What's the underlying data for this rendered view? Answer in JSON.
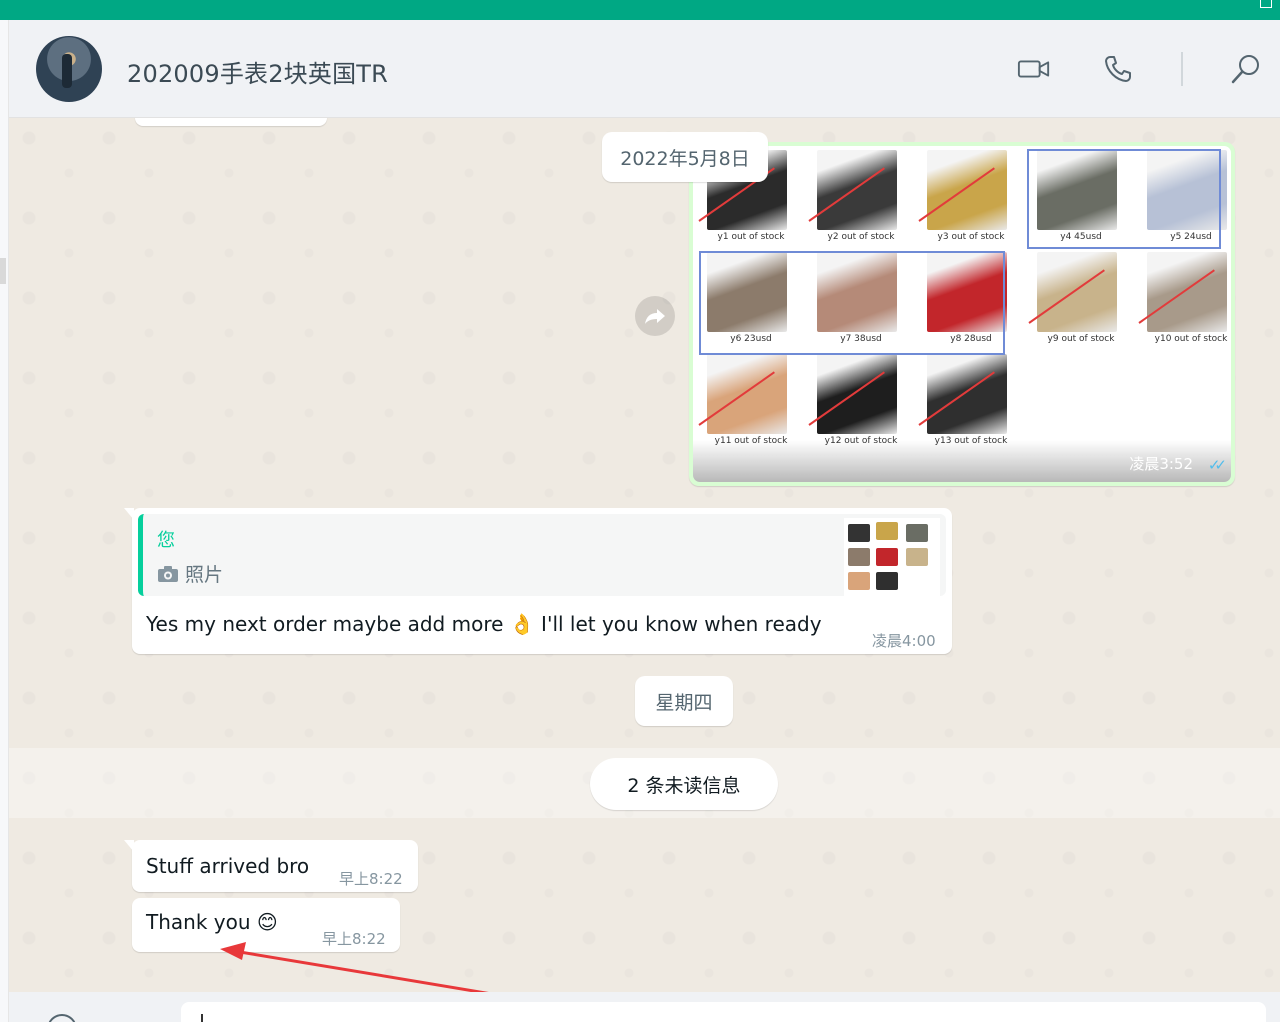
{
  "header": {
    "chat_title": "202009手表2块英国TR",
    "icons": [
      "video-call-icon",
      "voice-call-icon",
      "search-icon"
    ]
  },
  "date_pill": "2022年5月8日",
  "image_message": {
    "time": "凌晨3:52",
    "status": "read",
    "thumbnails": [
      {
        "caption": "y1  out of stock",
        "crossed": true,
        "color": "#2b2b2b"
      },
      {
        "caption": "y2   out of stock",
        "crossed": true,
        "color": "#3a3a3a"
      },
      {
        "caption": "y3   out of stock",
        "crossed": true,
        "color": "#c9a54a"
      },
      {
        "caption": "y4  45usd",
        "crossed": false,
        "color": "#6a6d64"
      },
      {
        "caption": "y5  24usd",
        "crossed": false,
        "color": "#b7c1d6"
      },
      {
        "caption": "y6 23usd",
        "crossed": false,
        "color": "#8c7b6b"
      },
      {
        "caption": "y7   38usd",
        "crossed": false,
        "color": "#b58a78"
      },
      {
        "caption": "y8  28usd",
        "crossed": false,
        "color": "#c2262b"
      },
      {
        "caption": "y9    out of stock",
        "crossed": true,
        "color": "#c8b38b"
      },
      {
        "caption": "y10  out of stock",
        "crossed": true,
        "color": "#a89a8a"
      },
      {
        "caption": "y11  out of stock",
        "crossed": true,
        "color": "#d9a47a"
      },
      {
        "caption": "y12  out of stock",
        "crossed": true,
        "color": "#1e1e1e"
      },
      {
        "caption": "y13  out of stock",
        "crossed": true,
        "color": "#2f2f2f"
      }
    ]
  },
  "reply_message": {
    "quoted_author": "您",
    "quoted_type": "照片",
    "text": "Yes my next order maybe add more",
    "emoji": "👌",
    "text2": "I'll let you know when ready",
    "time": "凌晨4:00"
  },
  "day_pill": "星期四",
  "unread_pill": "2 条未读信息",
  "messages": [
    {
      "text": "Stuff arrived bro",
      "time": "早上8:22"
    },
    {
      "text": "Thank you",
      "emoji": "😊",
      "time": "早上8:22"
    }
  ],
  "colors": {
    "accent": "#00a884",
    "outgoing_bubble": "#d9fdd3",
    "quote_bar": "#06cf9c",
    "read_ticks": "#53bdeb",
    "annotation_arrow": "#e8383a"
  }
}
